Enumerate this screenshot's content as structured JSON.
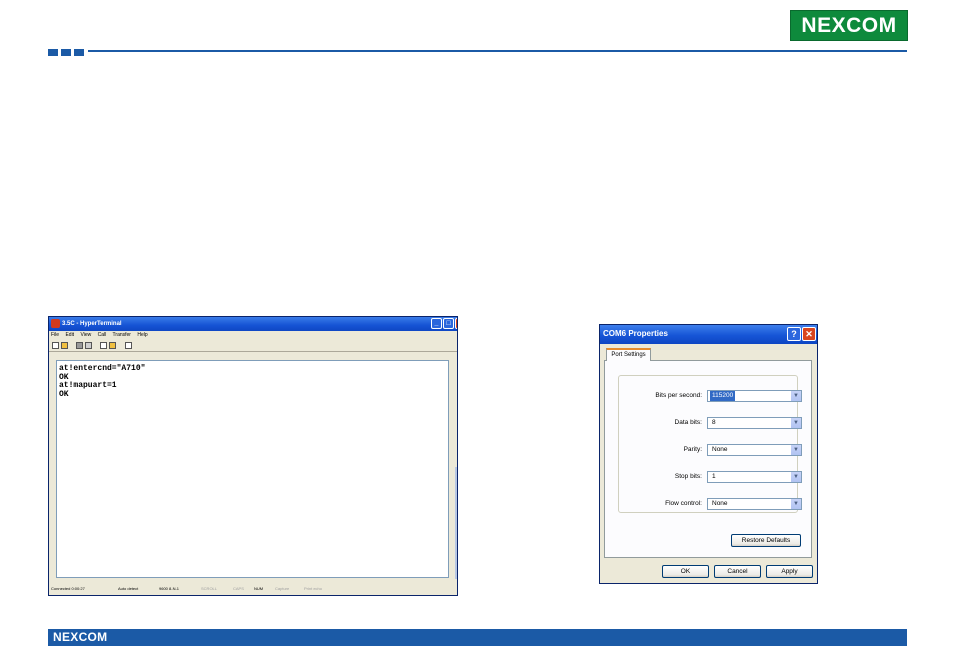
{
  "header": {
    "logo": "NEXCOM"
  },
  "footer": {
    "logo": "NEXCOM"
  },
  "hyperterminal": {
    "title": "3.5C - HyperTerminal",
    "menu": [
      "File",
      "Edit",
      "View",
      "Call",
      "Transfer",
      "Help"
    ],
    "terminal_lines": [
      "at!entercnd=\"A710\"",
      "OK",
      "at!mapuart=1",
      "OK"
    ],
    "status": {
      "connected": "Connected 0:00:27",
      "detect": "Auto detect",
      "settings": "9600 8-N-1",
      "scroll": "SCROLL",
      "caps": "CAPS",
      "num": "NUM",
      "capture": "Capture",
      "echo": "Print echo"
    }
  },
  "dialog": {
    "title": "COM6 Properties",
    "tab": "Port Settings",
    "fields": [
      {
        "label": "Bits per second:",
        "value": "115200"
      },
      {
        "label": "Data bits:",
        "value": "8"
      },
      {
        "label": "Parity:",
        "value": "None"
      },
      {
        "label": "Stop bits:",
        "value": "1"
      },
      {
        "label": "Flow control:",
        "value": "None"
      }
    ],
    "restore_label": "Restore Defaults",
    "ok_label": "OK",
    "cancel_label": "Cancel",
    "apply_label": "Apply",
    "help_glyph": "?",
    "close_glyph": "✕"
  }
}
